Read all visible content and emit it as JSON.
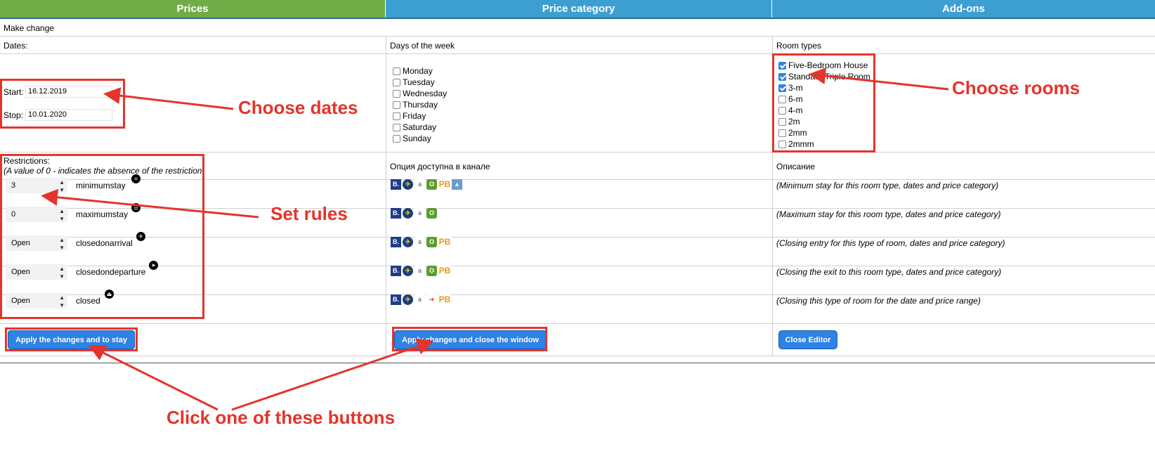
{
  "tabs": [
    "Prices",
    "Price category",
    "Add-ons"
  ],
  "make_change": "Make change",
  "dates": {
    "label": "Dates:",
    "start_label": "Start:",
    "start_value": "16.12.2019",
    "stop_label": "Stop:",
    "stop_value": "10.01.2020"
  },
  "days": {
    "label": "Days of the week",
    "items": [
      "Monday",
      "Tuesday",
      "Wednesday",
      "Thursday",
      "Friday",
      "Saturday",
      "Sunday"
    ]
  },
  "rooms": {
    "label": "Room types",
    "items": [
      {
        "name": "Five-Bedroom House",
        "checked": true
      },
      {
        "name": "Standard Triple Room",
        "checked": true
      },
      {
        "name": "3-m",
        "checked": true
      },
      {
        "name": "6-m",
        "checked": false
      },
      {
        "name": "4-m",
        "checked": false
      },
      {
        "name": "2m",
        "checked": false
      },
      {
        "name": "2mm",
        "checked": false
      },
      {
        "name": "2mmm",
        "checked": false
      }
    ]
  },
  "restrictions": {
    "label": "Restrictions:",
    "note": "(A value of 0 - indicates the absence of the restriction",
    "channel_header": "Опция доступна в канале",
    "desc_header": "Описание",
    "rows": [
      {
        "value": "3",
        "name": "minimumstay",
        "desc": "(Minimum stay for this room type, dates and price category)"
      },
      {
        "value": "0",
        "name": "maximumstay",
        "desc": "(Maximum stay for this room type, dates and price category)"
      },
      {
        "value": "Open",
        "name": "closedonarrival",
        "desc": "(Closing entry for this type of room, dates and price category)"
      },
      {
        "value": "Open",
        "name": "closedondeparture",
        "desc": "(Closing the exit to this room type, dates and price category)"
      },
      {
        "value": "Open",
        "name": "closed",
        "desc": "(Closing this type of room for the date and price range)"
      }
    ]
  },
  "buttons": {
    "apply_stay": "Apply the changes and to stay",
    "apply_close": "Apply changes and close the window",
    "close_editor": "Close Editor"
  },
  "annotations": {
    "choose_dates": "Choose dates",
    "choose_rooms": "Choose rooms",
    "set_rules": "Set rules",
    "click_buttons": "Click one of these buttons"
  },
  "colors": {
    "tab_green": "#70ad47",
    "tab_blue": "#3d9fd1",
    "button_blue": "#2f82e6",
    "annotation_red": "#e5342b"
  }
}
